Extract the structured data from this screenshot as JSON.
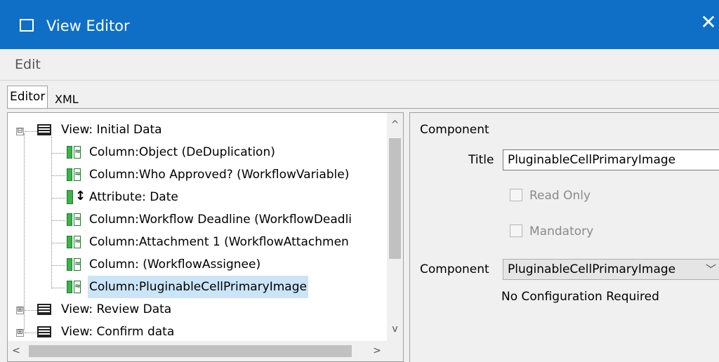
{
  "window": {
    "title": "View Editor",
    "close_glyph": "✕",
    "accent_color": "#0f6fc6"
  },
  "menu": {
    "edit": "Edit"
  },
  "tabs": {
    "editor": "Editor",
    "xml": "XML"
  },
  "tree": {
    "items": [
      {
        "label": "View: Initial Data",
        "icon": "view-icon",
        "expander": "⊟"
      },
      {
        "label": "Column:Object (DeDuplication)",
        "icon": "column-icon"
      },
      {
        "label": "Column:Who Approved? (WorkflowVariable)",
        "icon": "column-icon"
      },
      {
        "label": "Attribute: Date",
        "icon": "attribute-icon"
      },
      {
        "label": "Column:Workflow Deadline (WorkflowDeadli",
        "icon": "column-icon"
      },
      {
        "label": "Column:Attachment 1 (WorkflowAttachmen",
        "icon": "column-icon"
      },
      {
        "label": "Column: (WorkflowAssignee)",
        "icon": "column-icon"
      },
      {
        "label": "Column:PluginableCellPrimaryImage",
        "icon": "column-icon",
        "selected": true
      },
      {
        "label": "View: Review Data",
        "icon": "view-icon",
        "expander": "⊞"
      },
      {
        "label": "View: Confirm data",
        "icon": "view-icon",
        "expander": "⊞"
      }
    ],
    "scroll_up": "^",
    "scroll_down": "v",
    "scroll_left": "<",
    "scroll_right": ">"
  },
  "component_panel": {
    "group_title": "Component",
    "title_label": "Title",
    "title_value": "PluginableCellPrimaryImage",
    "read_only_label": "Read Only",
    "mandatory_label": "Mandatory",
    "component_label": "Component",
    "component_value": "PluginableCellPrimaryImage",
    "component_chevron": "﹀",
    "no_config_text": "No Configuration Required"
  }
}
